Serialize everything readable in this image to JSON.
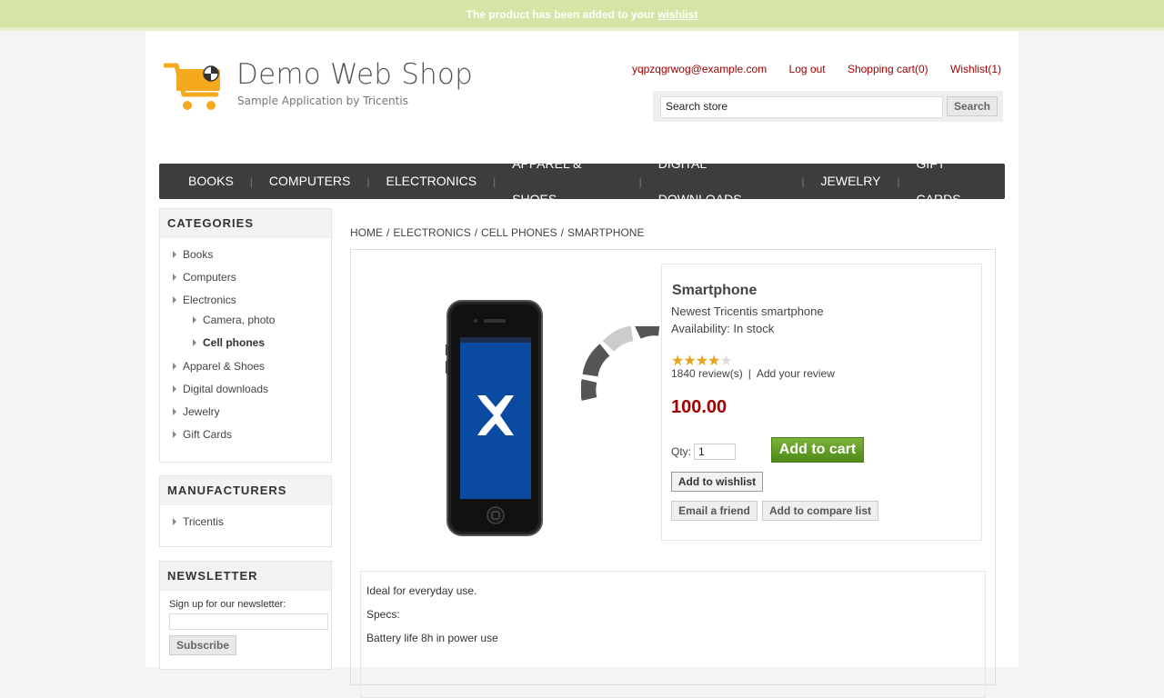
{
  "notice": {
    "text": "The product has been added to your ",
    "link": "wishlist"
  },
  "header": {
    "title": "Demo Web Shop",
    "subtitle": "Sample Application by Tricentis",
    "account_email": "yqpzqgrwog@example.com",
    "logout": "Log out",
    "cart": "Shopping cart(0)",
    "wishlist": "Wishlist(1)",
    "search_placeholder": "Search store",
    "search_button": "Search"
  },
  "nav": [
    "BOOKS",
    "COMPUTERS",
    "ELECTRONICS",
    "APPAREL & SHOES",
    "DIGITAL DOWNLOADS",
    "JEWELRY",
    "GIFT CARDS"
  ],
  "sidebar": {
    "categories_title": "CATEGORIES",
    "categories": [
      "Books",
      "Computers",
      "Electronics",
      "Camera, photo",
      "Cell phones",
      "Apparel & Shoes",
      "Digital downloads",
      "Jewelry",
      "Gift Cards"
    ],
    "manufacturers_title": "MANUFACTURERS",
    "manufacturers": [
      "Tricentis"
    ],
    "newsletter_title": "NEWSLETTER",
    "newsletter_label": "Sign up for our newsletter:",
    "subscribe": "Subscribe"
  },
  "breadcrumb": [
    "HOME",
    "ELECTRONICS",
    "CELL PHONES",
    "SMARTPHONE"
  ],
  "product": {
    "name": "Smartphone",
    "short": "Newest Tricentis smartphone",
    "availability": "Availability: In stock",
    "rating": 3.5,
    "reviews": "1840 review(s)",
    "add_review": "Add your review",
    "price": "100.00",
    "qty_label": "Qty:",
    "qty": "1",
    "add_to_cart": "Add to cart",
    "add_to_wishlist": "Add to wishlist",
    "email_friend": "Email a friend",
    "compare": "Add to compare list",
    "desc": [
      "Ideal for everyday use.",
      "Specs:",
      "Battery life 8h in power use"
    ]
  },
  "colors": {
    "accent_red": "#a40000",
    "nav_bg": "#3d3d3d",
    "cart_green": "#5d9a22",
    "notice_bg": "#d6e4a5"
  }
}
